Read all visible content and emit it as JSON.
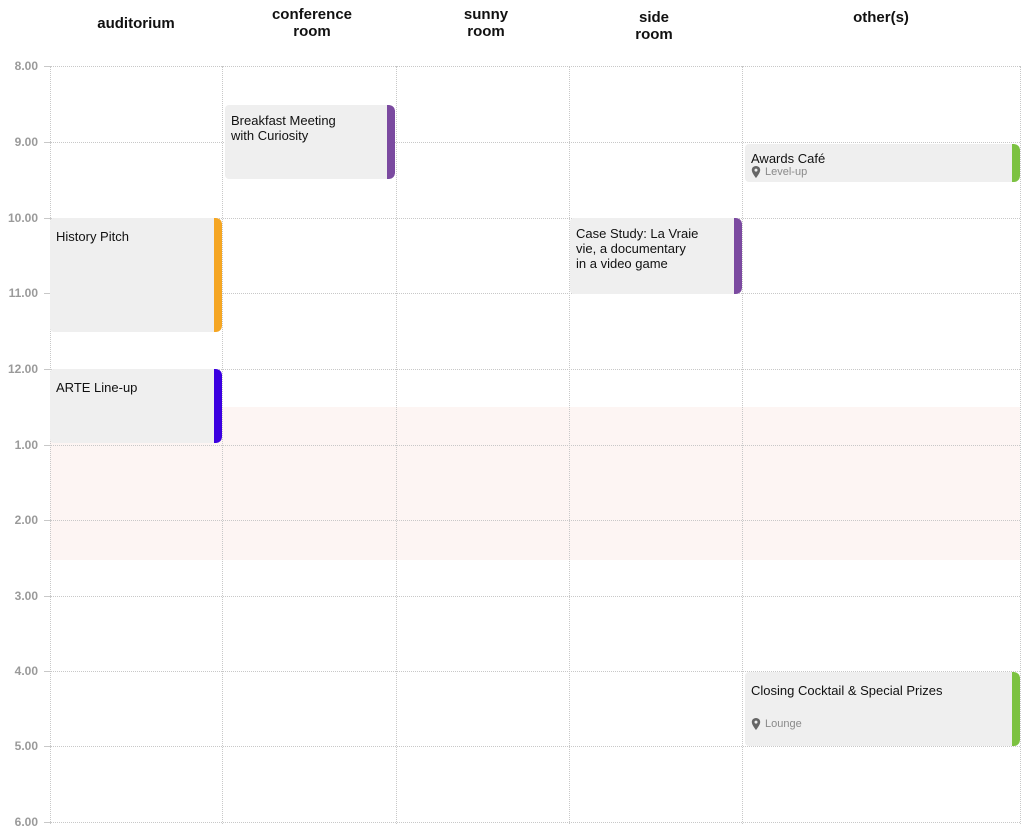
{
  "columns": [
    {
      "label": "auditorium"
    },
    {
      "label": "conference\nroom"
    },
    {
      "label": "sunny\nroom"
    },
    {
      "label": "side\nroom"
    },
    {
      "label": "other(s)"
    }
  ],
  "times": [
    "8.00",
    "9.00",
    "10.00",
    "11.00",
    "12.00",
    "1.00",
    "2.00",
    "3.00",
    "4.00",
    "5.00",
    "6.00"
  ],
  "colors": {
    "orange": "#f5a623",
    "purple": "#7b4aa0",
    "violet": "#3b00e0",
    "green": "#7cc241",
    "break": "#fdf5f3"
  },
  "events": [
    {
      "title": "Breakfast Meeting\nwith Curiosity",
      "location": "",
      "color": "#7b4aa0"
    },
    {
      "title": "Awards Café",
      "location": "Level-up",
      "color": "#7cc241"
    },
    {
      "title": "History Pitch",
      "location": "",
      "color": "#f5a623"
    },
    {
      "title": "Case Study: La Vraie\nvie, a documentary\nin a video game",
      "location": "",
      "color": "#7b4aa0"
    },
    {
      "title": "ARTE Line-up",
      "location": "",
      "color": "#3b00e0"
    },
    {
      "title": "Closing Cocktail & Special Prizes",
      "location": "Lounge",
      "color": "#7cc241"
    }
  ],
  "icons": {
    "location": "map-pin-icon"
  }
}
